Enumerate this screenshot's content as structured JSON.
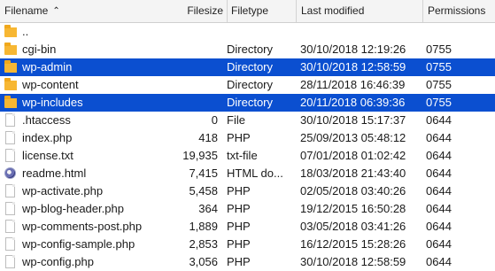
{
  "header": {
    "filename": "Filename",
    "filesize": "Filesize",
    "filetype": "Filetype",
    "last_modified": "Last modified",
    "permissions": "Permissions",
    "sort_indicator": "^"
  },
  "rows": [
    {
      "icon": "folder-icon",
      "name": "..",
      "size": "",
      "type": "",
      "modified": "",
      "perm": "",
      "selected": false
    },
    {
      "icon": "folder-icon",
      "name": "cgi-bin",
      "size": "",
      "type": "Directory",
      "modified": "30/10/2018 12:19:26",
      "perm": "0755",
      "selected": false
    },
    {
      "icon": "folder-icon",
      "name": "wp-admin",
      "size": "",
      "type": "Directory",
      "modified": "30/10/2018 12:58:59",
      "perm": "0755",
      "selected": true
    },
    {
      "icon": "folder-icon",
      "name": "wp-content",
      "size": "",
      "type": "Directory",
      "modified": "28/11/2018 16:46:39",
      "perm": "0755",
      "selected": false
    },
    {
      "icon": "folder-icon",
      "name": "wp-includes",
      "size": "",
      "type": "Directory",
      "modified": "20/11/2018 06:39:36",
      "perm": "0755",
      "selected": true
    },
    {
      "icon": "file-icon",
      "name": ".htaccess",
      "size": "0",
      "type": "File",
      "modified": "30/10/2018 15:17:37",
      "perm": "0644",
      "selected": false
    },
    {
      "icon": "file-icon",
      "name": "index.php",
      "size": "418",
      "type": "PHP",
      "modified": "25/09/2013 05:48:12",
      "perm": "0644",
      "selected": false
    },
    {
      "icon": "file-icon",
      "name": "license.txt",
      "size": "19,935",
      "type": "txt-file",
      "modified": "07/01/2018 01:02:42",
      "perm": "0644",
      "selected": false
    },
    {
      "icon": "web-icon",
      "name": "readme.html",
      "size": "7,415",
      "type": "HTML do...",
      "modified": "18/03/2018 21:43:40",
      "perm": "0644",
      "selected": false
    },
    {
      "icon": "file-icon",
      "name": "wp-activate.php",
      "size": "5,458",
      "type": "PHP",
      "modified": "02/05/2018 03:40:26",
      "perm": "0644",
      "selected": false
    },
    {
      "icon": "file-icon",
      "name": "wp-blog-header.php",
      "size": "364",
      "type": "PHP",
      "modified": "19/12/2015 16:50:28",
      "perm": "0644",
      "selected": false
    },
    {
      "icon": "file-icon",
      "name": "wp-comments-post.php",
      "size": "1,889",
      "type": "PHP",
      "modified": "03/05/2018 03:41:26",
      "perm": "0644",
      "selected": false
    },
    {
      "icon": "file-icon",
      "name": "wp-config-sample.php",
      "size": "2,853",
      "type": "PHP",
      "modified": "16/12/2015 15:28:26",
      "perm": "0644",
      "selected": false
    },
    {
      "icon": "file-icon",
      "name": "wp-config.php",
      "size": "3,056",
      "type": "PHP",
      "modified": "30/10/2018 12:58:59",
      "perm": "0644",
      "selected": false
    }
  ],
  "colors": {
    "selection": "#0b4fd0",
    "folder": "#f7b733"
  }
}
